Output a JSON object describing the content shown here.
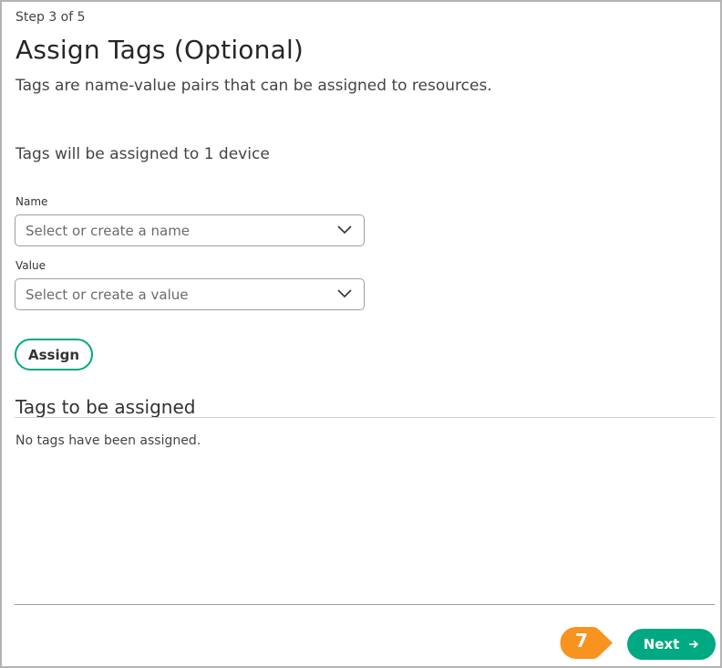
{
  "wizard": {
    "step_text": "Step 3 of 5",
    "title": "Assign Tags (Optional)",
    "subtitle": "Tags are name-value pairs that can be assigned to resources.",
    "device_note": "Tags will be assigned to 1 device"
  },
  "form": {
    "name": {
      "label": "Name",
      "placeholder": "Select or create a name"
    },
    "value": {
      "label": "Value",
      "placeholder": "Select or create a value"
    },
    "assign_label": "Assign"
  },
  "tags_section": {
    "title": "Tags to be assigned",
    "empty_message": "No tags have been assigned."
  },
  "footer": {
    "callout_number": "7",
    "next_label": "Next"
  },
  "colors": {
    "accent": "#01a982",
    "callout": "#f7931e"
  },
  "icons": {
    "dropdown": "chevron-down-icon",
    "next": "arrow-right-icon"
  }
}
